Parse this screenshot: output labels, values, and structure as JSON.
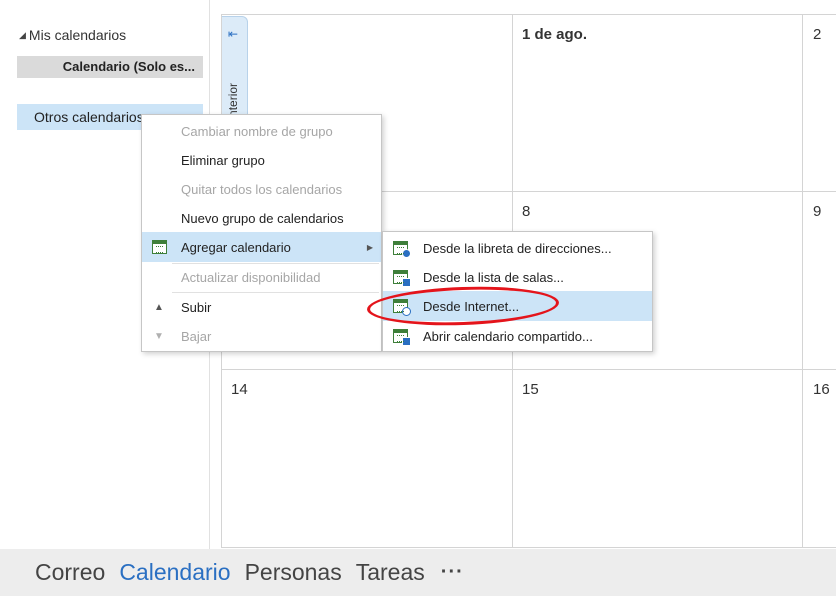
{
  "sidebar": {
    "my_calendars_label": "Mis calendarios",
    "calendar_item": "Calendario (Solo es...",
    "other_calendars_label": "Otros calendarios"
  },
  "calendar": {
    "prev_tab_text": "ta anterior",
    "week1": [
      "1 de ago.",
      "2"
    ],
    "week2": [
      "8",
      "9"
    ],
    "week3": [
      "14",
      "15",
      "16"
    ]
  },
  "context_menu": {
    "items": [
      {
        "label": "Cambiar nombre de grupo",
        "enabled": false
      },
      {
        "label": "Eliminar grupo",
        "enabled": true
      },
      {
        "label": "Quitar todos los calendarios",
        "enabled": false
      },
      {
        "label": "Nuevo grupo de calendarios",
        "enabled": true
      },
      {
        "label": "Agregar calendario",
        "enabled": true,
        "icon": "add-calendar-icon",
        "has_submenu": true,
        "highlighted": true
      },
      {
        "label": "Actualizar disponibilidad",
        "enabled": false
      },
      {
        "label": "Subir",
        "enabled": true,
        "icon": "move-up-icon"
      },
      {
        "label": "Bajar",
        "enabled": false,
        "icon": "move-down-icon"
      }
    ]
  },
  "submenu": {
    "items": [
      {
        "label": "Desde la libreta de direcciones...",
        "icon": "address-book-calendar-icon"
      },
      {
        "label": "Desde la lista de salas...",
        "icon": "room-list-calendar-icon"
      },
      {
        "label": "Desde Internet...",
        "icon": "internet-calendar-icon",
        "highlighted": true
      },
      {
        "label": "Abrir calendario compartido...",
        "icon": "shared-calendar-icon"
      }
    ]
  },
  "nav": {
    "items": [
      {
        "label": "Correo",
        "active": false
      },
      {
        "label": "Calendario",
        "active": true
      },
      {
        "label": "Personas",
        "active": false
      },
      {
        "label": "Tareas",
        "active": false
      }
    ],
    "more_label": "···"
  },
  "colors": {
    "accent": "#2a6fc2",
    "highlight": "#cce4f7",
    "annotation": "#e4141b"
  }
}
